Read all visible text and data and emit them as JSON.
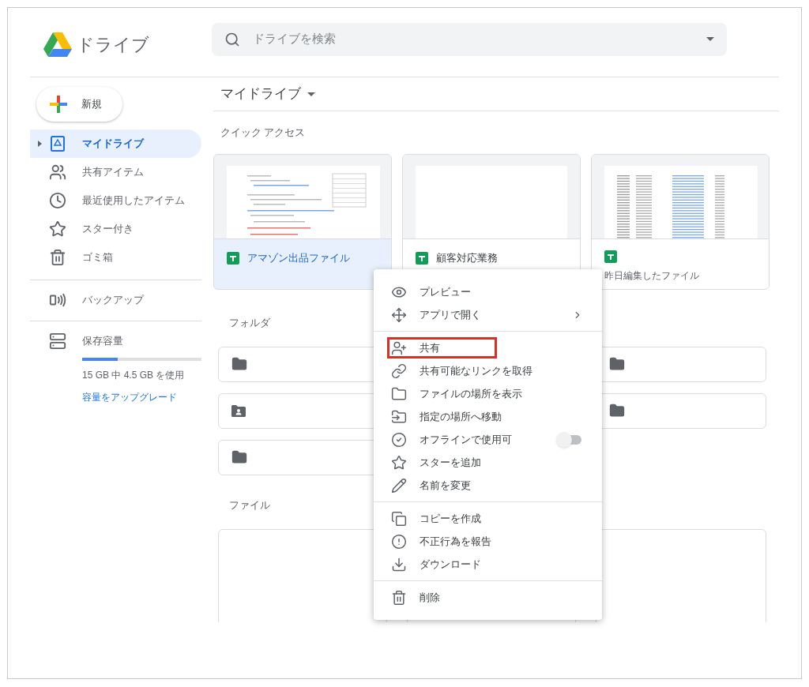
{
  "header": {
    "logo_text": "ドライブ",
    "search": {
      "placeholder": "ドライブを検索"
    }
  },
  "sidebar": {
    "new_button": "新規",
    "items": [
      {
        "label": "マイドライブ",
        "selected": true,
        "expandable": true
      },
      {
        "label": "共有アイテム",
        "selected": false,
        "expandable": false
      },
      {
        "label": "最近使用したアイテム",
        "selected": false,
        "expandable": false
      },
      {
        "label": "スター付き",
        "selected": false,
        "expandable": false
      },
      {
        "label": "ゴミ箱",
        "selected": false,
        "expandable": false
      }
    ],
    "backup": {
      "label": "バックアップ"
    },
    "storage": {
      "label": "保存容量",
      "level": 0.3,
      "usage": "15 GB 中 4.5 GB を使用",
      "upgrade_link": "容量をアップグレード"
    }
  },
  "breadcrumb": "マイドライブ",
  "quick_access": {
    "title": "クイック アクセス",
    "cards": [
      {
        "name": "アマゾン出品ファイル",
        "selected": true
      },
      {
        "name": "顧客対応業務",
        "selected": false
      },
      {
        "subtitle": "昨日編集したファイル",
        "selected": false
      }
    ]
  },
  "folders": {
    "title": "フォルダ",
    "items": [
      {
        "kind": "folder"
      },
      {
        "kind": "folder"
      },
      {
        "kind": "shared"
      },
      {
        "kind": "folder"
      },
      {
        "kind": "folder"
      }
    ]
  },
  "files": {
    "title": "ファイル"
  },
  "context_menu": {
    "groups": [
      [
        {
          "label": "プレビュー",
          "kind": "plain",
          "highlighted": false
        },
        {
          "label": "アプリで開く",
          "kind": "submenu",
          "highlighted": false
        }
      ],
      [
        {
          "label": "共有",
          "kind": "plain",
          "highlighted": true
        },
        {
          "label": "共有可能なリンクを取得",
          "kind": "plain",
          "highlighted": false
        },
        {
          "label": "ファイルの場所を表示",
          "kind": "plain",
          "highlighted": false
        },
        {
          "label": "指定の場所へ移動",
          "kind": "plain",
          "highlighted": false
        },
        {
          "label": "オフラインで使用可",
          "kind": "toggle",
          "on": false,
          "highlighted": false
        },
        {
          "label": "スターを追加",
          "kind": "plain",
          "highlighted": false
        },
        {
          "label": "名前を変更",
          "kind": "plain",
          "highlighted": false
        }
      ],
      [
        {
          "label": "コピーを作成",
          "kind": "plain",
          "highlighted": false
        },
        {
          "label": "不正行為を報告",
          "kind": "plain",
          "highlighted": false
        },
        {
          "label": "ダウンロード",
          "kind": "plain",
          "highlighted": false
        }
      ],
      [
        {
          "label": "削除",
          "kind": "plain",
          "highlighted": false
        }
      ]
    ]
  }
}
